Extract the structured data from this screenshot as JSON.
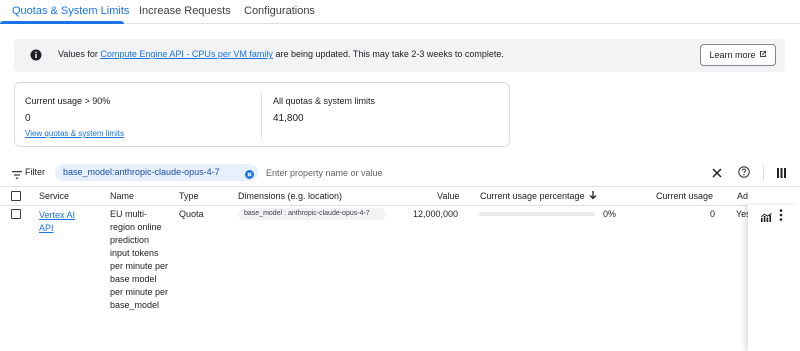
{
  "tabs": [
    {
      "label": "Quotas & System Limits",
      "active": true
    },
    {
      "label": "Increase Requests",
      "active": false
    },
    {
      "label": "Configurations",
      "active": false
    }
  ],
  "banner": {
    "prefix": "Values for ",
    "link": "Compute Engine API - CPUs per VM family",
    "suffix": " are being updated. This may take 2-3 weeks to complete.",
    "button": "Learn more"
  },
  "summary": {
    "usage_label": "Current usage > 90%",
    "usage_value": "0",
    "view_link": "View quotas & system limits",
    "all_label": "All quotas & system limits",
    "all_value": "41,800"
  },
  "filter": {
    "label": "Filter",
    "chip": "base_model:anthropic-claude-opus-4-7",
    "placeholder": "Enter property name or value"
  },
  "table": {
    "headers": {
      "service": "Service",
      "name": "Name",
      "type": "Type",
      "dimensions": "Dimensions (e.g. location)",
      "value": "Value",
      "usage_pct": "Current usage percentage",
      "current_usage": "Current usage",
      "adjustable": "Ad"
    },
    "rows": [
      {
        "service": "Vertex AI API",
        "name": "EU multi-region online prediction input tokens per minute per base model per minute per base_model",
        "type": "Quota",
        "dimension": "base_model : anthropic-claude-opus-4-7",
        "value": "12,000,000",
        "usage_pct_label": "0%",
        "usage_fraction": 0,
        "current_usage": "0",
        "adjustable": "Yes"
      }
    ]
  },
  "colors": {
    "accent": "#1a73e8",
    "chip_bg": "#e8f0fe",
    "banner_bg": "#f1f3f4",
    "border": "#dadce0"
  },
  "icons": {
    "banner": "info-icon",
    "learn_more": "open-in-new-icon",
    "filter": "filter-list-icon",
    "chip_close": "cancel-icon",
    "clear": "close-icon",
    "help": "help-icon",
    "columns": "column-view-icon",
    "sort": "arrow-downward-icon",
    "row_chart": "monitoring-chart-icon",
    "row_more": "more-vert-icon"
  }
}
